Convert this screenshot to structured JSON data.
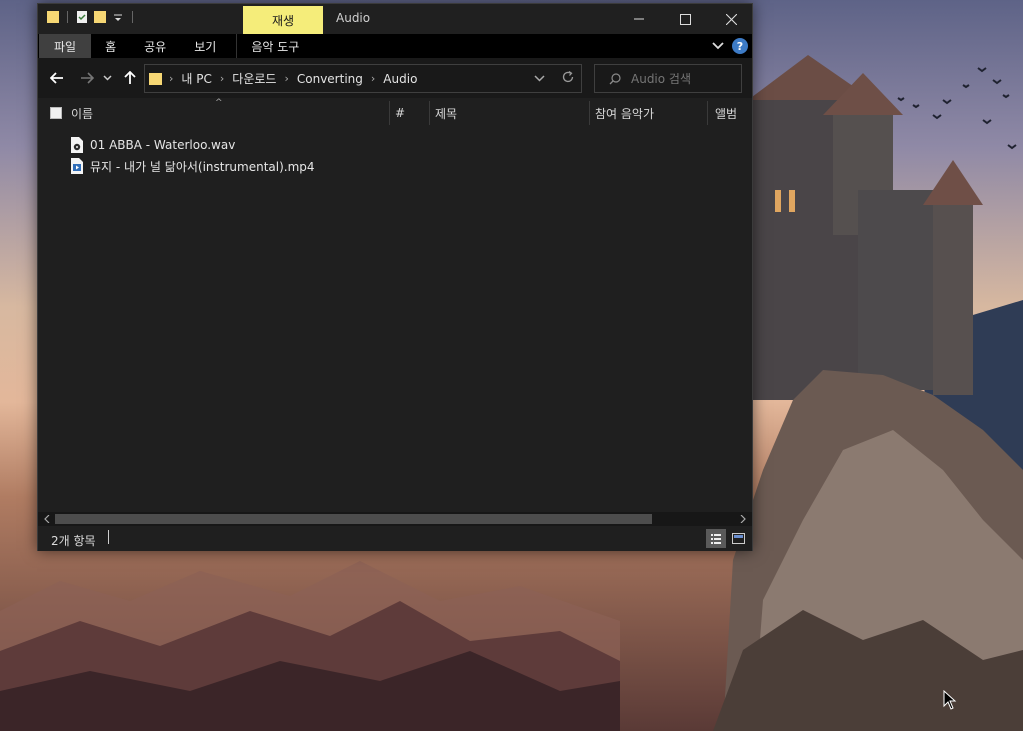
{
  "window": {
    "context_tab": "재생",
    "title": "Audio"
  },
  "ribbon": {
    "tabs": [
      "파일",
      "홈",
      "공유",
      "보기",
      "음악 도구"
    ],
    "help": "?"
  },
  "address": {
    "crumbs": [
      "내 PC",
      "다운로드",
      "Converting",
      "Audio"
    ]
  },
  "search": {
    "placeholder": "Audio 검색"
  },
  "columns": [
    "이름",
    "#",
    "제목",
    "참여 음악가",
    "앨범"
  ],
  "files": [
    {
      "name": "01 ABBA - Waterloo.wav",
      "icon": "audio-file-icon"
    },
    {
      "name": "뮤지 - 내가 널 닮아서(instrumental).mp4",
      "icon": "video-file-icon"
    }
  ],
  "status": {
    "count": "2개 항목"
  },
  "colors": {
    "window_bg": "#1f1f1f",
    "context_tab": "#f5ed7a",
    "accent": "#3d7bc6"
  }
}
